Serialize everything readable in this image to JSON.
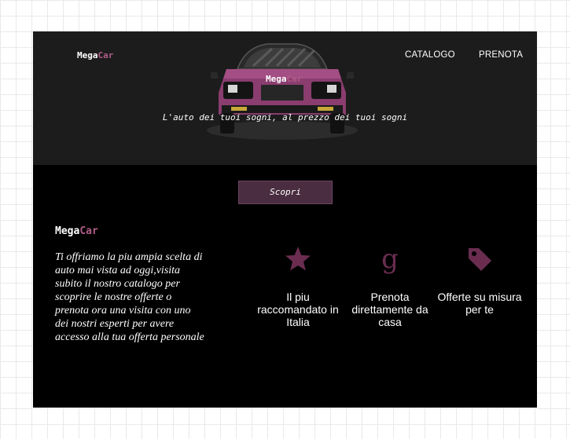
{
  "header": {
    "logo": {
      "part1": "Mega",
      "part2": "Car"
    },
    "nav": {
      "catalogo": "CATALOGO",
      "prenota": "PRENOTA"
    },
    "hero": {
      "logo": {
        "part1": "Mega",
        "part2": "Car"
      },
      "tagline": "L'auto dei tuoi sogni, al prezzo dei tuoi sogni"
    }
  },
  "cta": {
    "label": "Scopri"
  },
  "about": {
    "brand": {
      "part1": "Mega",
      "part2": "Car"
    },
    "description": "Ti offriamo la piu ampia scelta di auto mai vista ad oggi,visita subito il nostro catalogo per scoprire le nostre offerte o prenota ora una visita con uno dei nostri esperti per avere accesso alla tua offerta personale"
  },
  "features": [
    {
      "icon": "star-icon",
      "label": "Il piu raccomandato in Italia"
    },
    {
      "icon": "google-icon",
      "glyph": "g",
      "label": "Prenota direttamente da casa"
    },
    {
      "icon": "tag-icon",
      "label": "Offerte su misura per te"
    }
  ],
  "colors": {
    "accent": "#b05c88",
    "icon": "#6a2d50",
    "button": "#4a2d40",
    "hero_bg": "#1c1c1c",
    "page_bg": "#000000"
  }
}
